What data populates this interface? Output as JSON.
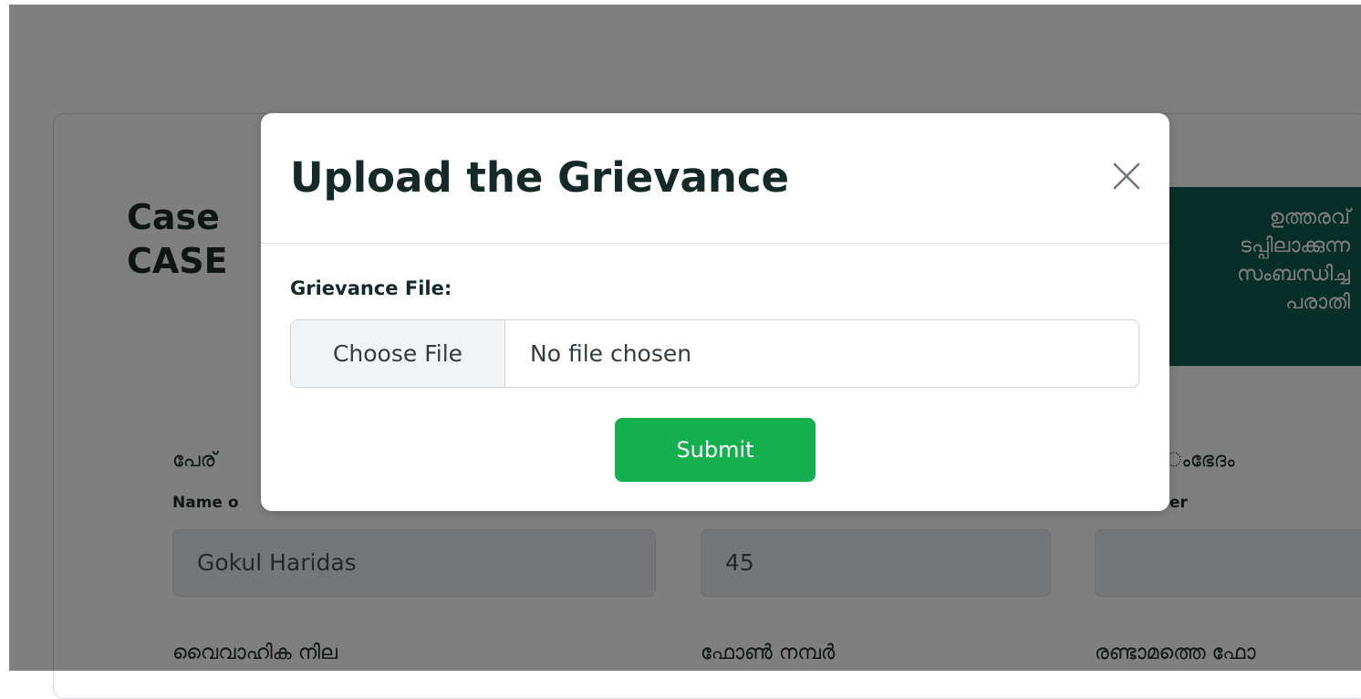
{
  "background_page": {
    "case_title_line1": "Case",
    "case_title_line2": "CASE",
    "banner_lines": [
      "ഉത്തരവ്",
      "ടപ്പിലാക്കുന്ന",
      "സംബന്ധിച്ച",
      "പരാതി"
    ],
    "fields": [
      {
        "label_ml": "പേര്",
        "label_en": "Name o",
        "value": "Gokul Haridas"
      },
      {
        "label_ml": "",
        "label_en": "",
        "value": "45"
      },
      {
        "label_ml": "ംഭേദം",
        "label_en": "er",
        "value": ""
      }
    ],
    "bottom_labels": [
      "വൈവാഹിക നില",
      "ഫോൺ നമ്പർ",
      "രണ്ടാമത്തെ ഫോ"
    ]
  },
  "modal": {
    "title": "Upload the Grievance",
    "file_label": "Grievance File:",
    "choose_file_label": "Choose File",
    "file_status": "No file chosen",
    "submit_label": "Submit",
    "close_icon": "close-icon"
  },
  "colors": {
    "banner_bg": "#0f5c4e",
    "submit_bg": "#14b04e",
    "backdrop": "rgba(0,0,0,0.5)"
  }
}
